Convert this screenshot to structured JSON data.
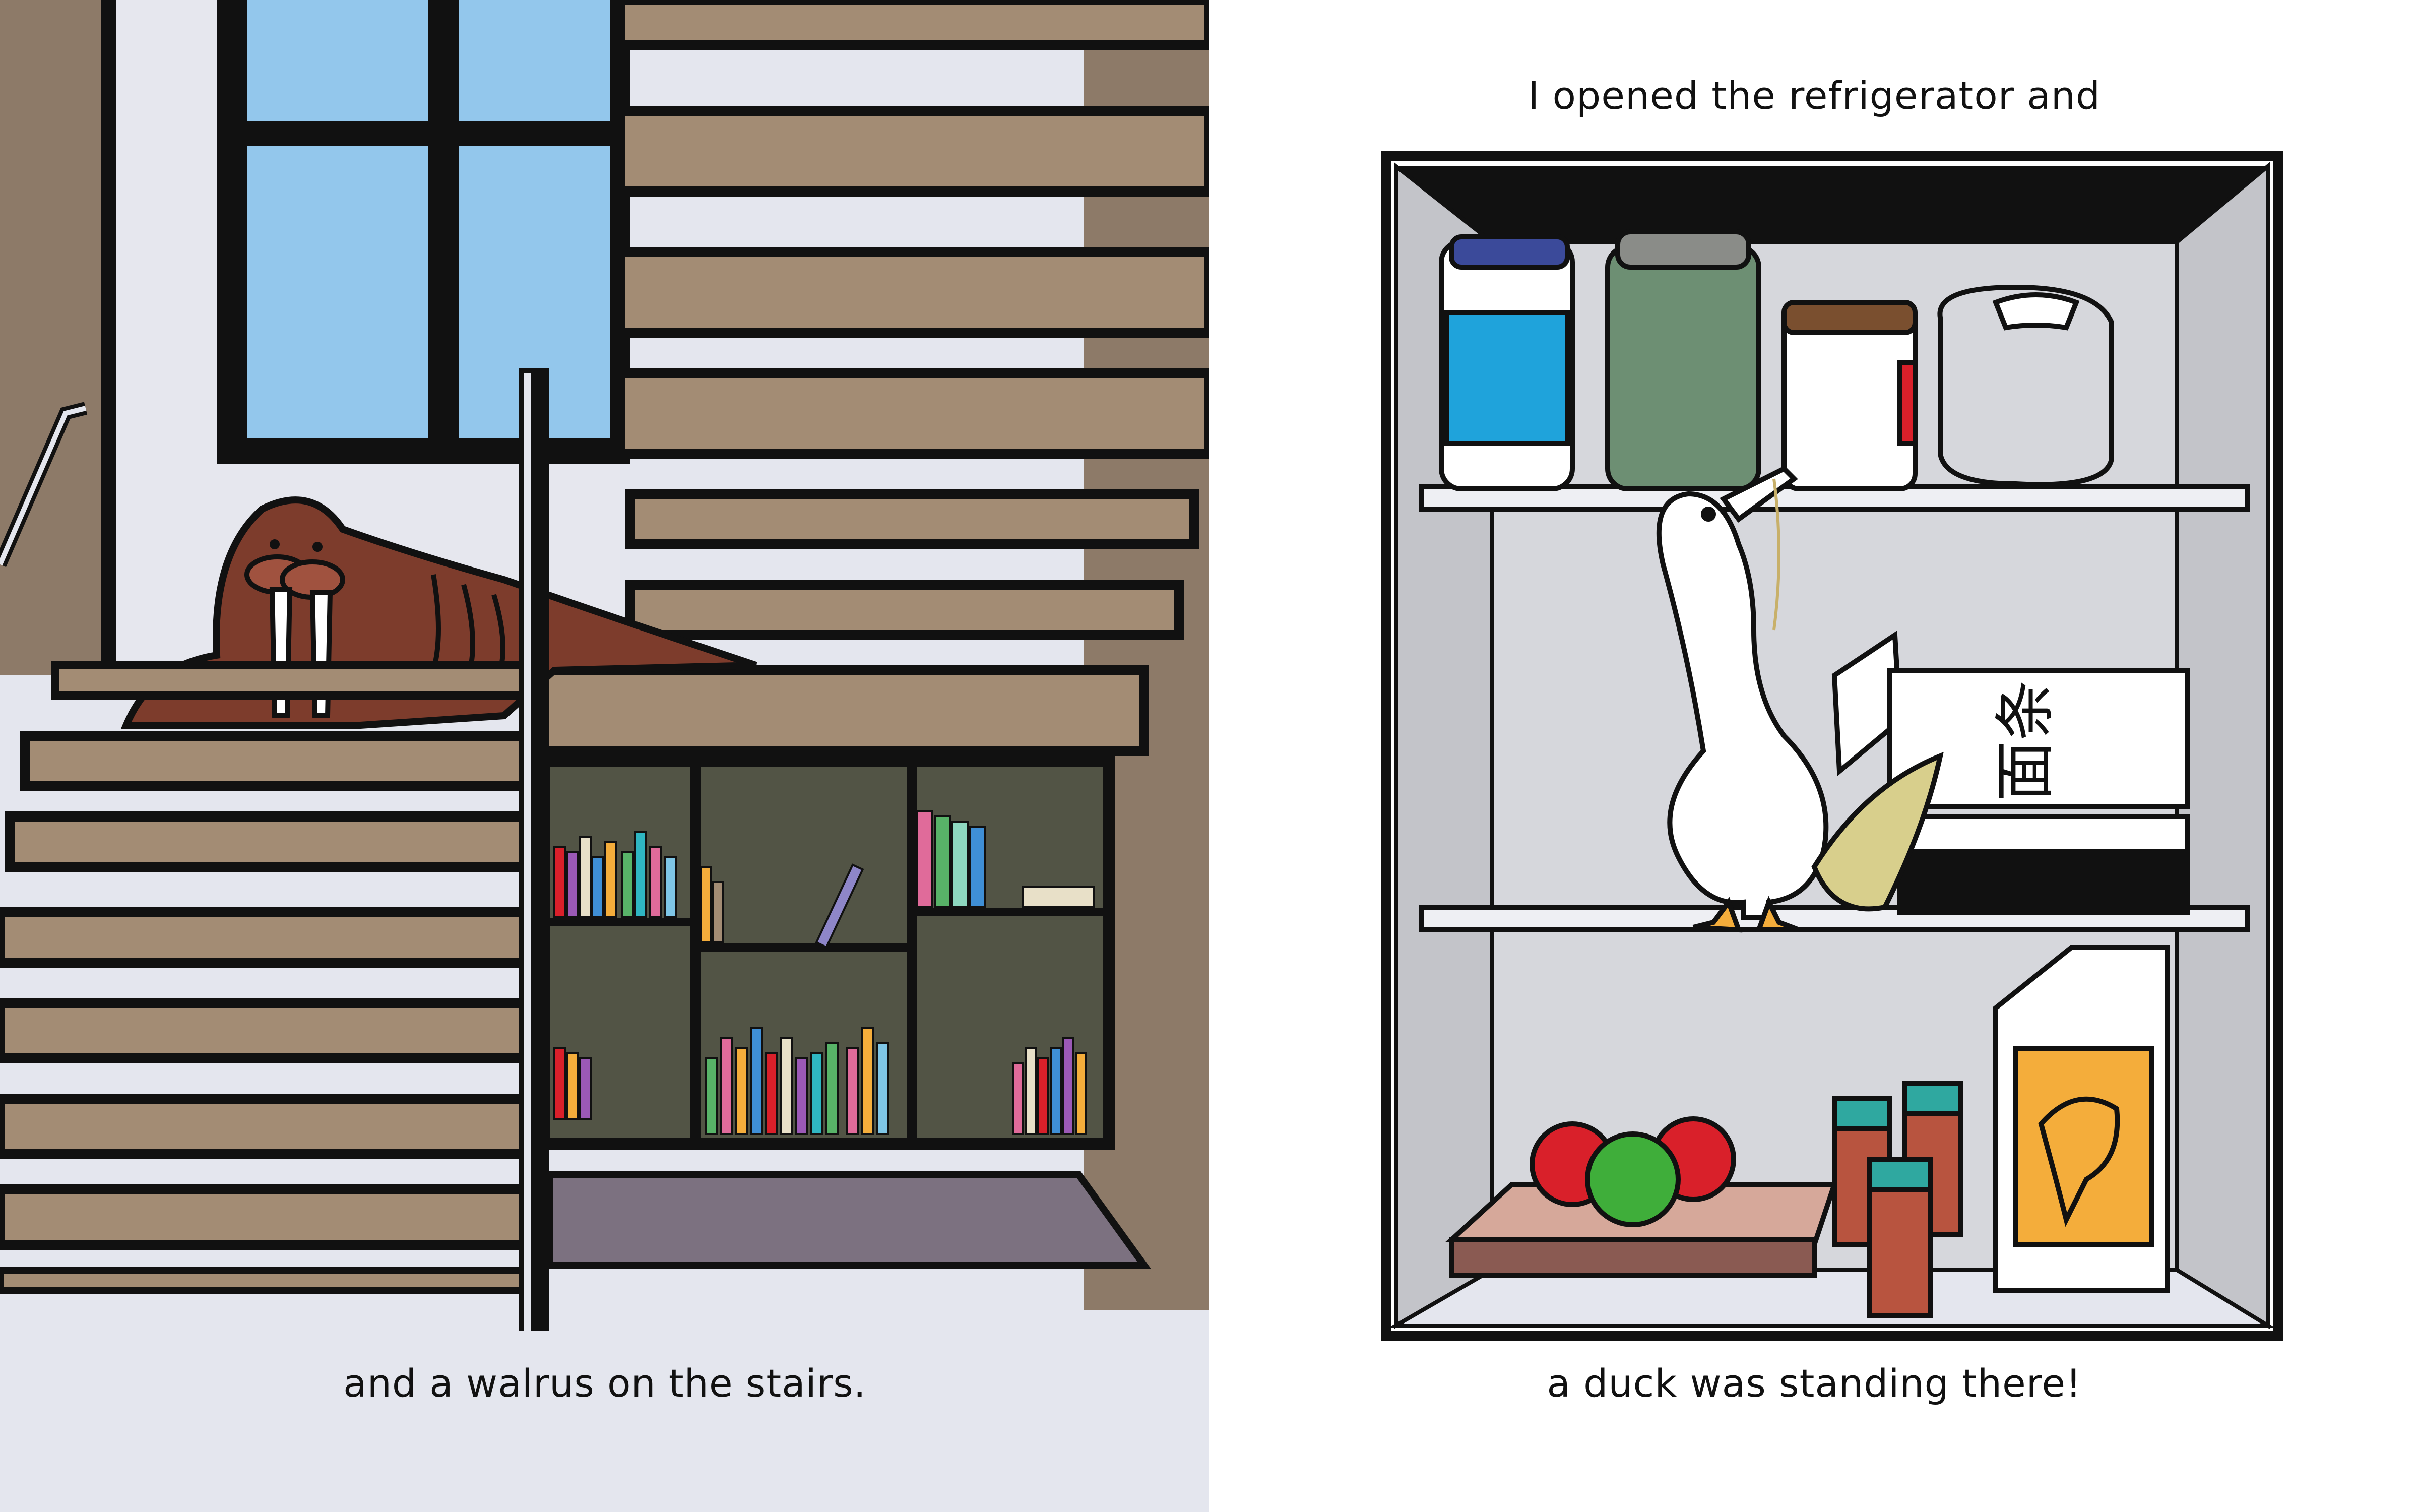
{
  "left_page": {
    "caption": "and a walrus on the stairs."
  },
  "right_page": {
    "caption_top": "I opened the refrigerator and",
    "caption_bottom": "a duck was standing there!",
    "noodle_box_label": "面条"
  },
  "colors": {
    "stair_tan": "#a38c74",
    "wall_brown": "#8d7a68",
    "window_blue": "#93c7ec",
    "walrus_brown": "#7d3c2c",
    "bookcase_dark": "#525445",
    "rug_purple": "#7c7180",
    "fridge_grey": "#c3c4c9",
    "apple_red": "#d9202a",
    "apple_green": "#3fae3a",
    "box_orange": "#f4ad3b"
  }
}
